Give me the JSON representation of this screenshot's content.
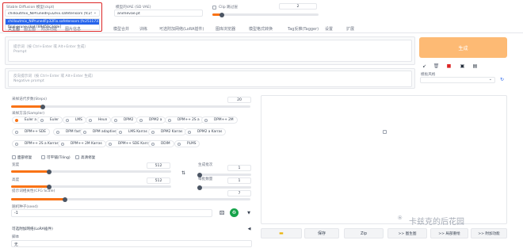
{
  "checkpoint": {
    "label": "Stable Diffusion 模型(ckpt)",
    "value": "chilloutmix_NiPrunedFp32Fix.safetensors [fc251",
    "dropdown_options": [
      "chilloutmix_NiPrunedFp32Fix.safetensors [fc2511737a]",
      "final-prune.ckpt [89d59c3dde]"
    ]
  },
  "vae": {
    "label": "模型的VAE (SD VAE)",
    "value": "animevae.pt"
  },
  "clip": {
    "label": "Clip 跳过层",
    "value": "2"
  },
  "tabs": [
    "文生图",
    "图生图",
    "附加功能",
    "图片信息",
    "模型合并",
    "训练",
    "可选附加网络(LoRA插件)",
    "图库浏览器",
    "模型格式转换",
    "Tag反推(Tagger)",
    "设置",
    "扩展"
  ],
  "prompt": {
    "placeholder_line1": "提示词（按 Ctrl+Enter 或 Alt+Enter 生成）",
    "placeholder_line2": "Prompt"
  },
  "negative_prompt": {
    "placeholder_line1": "反向提示词（按 Ctrl+Enter 或 Alt+Enter 生成）",
    "placeholder_line2": "Negative prompt"
  },
  "generate_label": "生成",
  "style_label": "模板风格",
  "steps": {
    "label": "采样迭代步数(Steps)",
    "value": "20"
  },
  "sampler": {
    "label": "采样方法(Sampler)",
    "selected": "Euler a",
    "options": [
      "Euler a",
      "Euler",
      "LMS",
      "Heun",
      "DPM2",
      "DPM2 a",
      "DPM++ 2S a",
      "DPM++ 2M",
      "DPM++ SDE",
      "DPM fast",
      "DPM adaptive",
      "LMS Karras",
      "DPM2 Karras",
      "DPM2 a Karras",
      "DPM++ 2S a Karras",
      "DPM++ 2M Karras",
      "DPM++ SDE Karras",
      "DDIM",
      "PLMS"
    ]
  },
  "checkboxes": [
    "面部修复",
    "可平铺(Tiling)",
    "高清修复"
  ],
  "width": {
    "label": "宽度",
    "value": "512"
  },
  "height": {
    "label": "高度",
    "value": "512"
  },
  "batch_count": {
    "label": "生成批次",
    "value": "1"
  },
  "batch_size": {
    "label": "每批数量",
    "value": "1"
  },
  "cfg": {
    "label": "提示词相关性(CFG Scale)",
    "value": "7"
  },
  "seed": {
    "label": "随机种子(seed)",
    "value": "-1"
  },
  "lora": {
    "label": "可选附加网络(LoRA插件)",
    "script_label": "脚本",
    "script_value": "无"
  },
  "output_buttons": [
    "保存",
    "Zip",
    ">> 图生图",
    ">> 局部重绘",
    ">> 附加功能"
  ],
  "watermark": "卡兹克的后花园"
}
